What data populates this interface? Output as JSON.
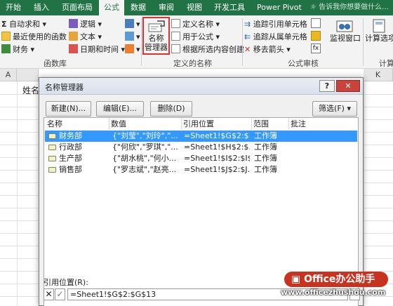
{
  "tabs": [
    {
      "label": "开始"
    },
    {
      "label": "插入"
    },
    {
      "label": "页面布局"
    },
    {
      "label": "公式"
    },
    {
      "label": "数据"
    },
    {
      "label": "审阅"
    },
    {
      "label": "视图"
    },
    {
      "label": "开发工具"
    },
    {
      "label": "Power Pivot"
    }
  ],
  "tell_me": "告诉我你想要做什么...",
  "ribbon": {
    "library": {
      "autosum": "自动求和",
      "recent": "最近使用的函数",
      "finance": "财务",
      "logic": "逻辑",
      "text": "文本",
      "datetime": "日期和时间",
      "label": "函数库"
    },
    "names": {
      "manager_line1": "名称",
      "manager_line2": "管理器",
      "define_name": "定义名称",
      "use_in_formula": "用于公式",
      "create_from_selection": "根据所选内容创建",
      "label": "定义的名称"
    },
    "audit": {
      "trace_precedents": "追踪引用单元格",
      "trace_dependents": "追踪从属单元格",
      "remove_arrows": "移去箭头",
      "watch_window": "监视窗口",
      "label": "公式审核"
    },
    "calc": {
      "options": "计算选项",
      "label": "计算"
    }
  },
  "sheet": {
    "col_a": "A",
    "col_k": "K",
    "cell_b1": "姓名"
  },
  "dialog": {
    "title": "名称管理器",
    "help": "?",
    "close": "✕",
    "new_button": "新建(N)...",
    "edit_button": "编辑(E)...",
    "delete_button": "删除(D)",
    "filter_button": "筛选(F) ▾",
    "columns": [
      "名称",
      "数值",
      "引用位置",
      "范围",
      "批注"
    ],
    "rows": [
      {
        "name": "财务部",
        "value": "{\"刘莹\",\"刘玲\",\"...",
        "ref": "=Sheet1!$G$2:$...",
        "scope": "工作簿",
        "selected": true
      },
      {
        "name": "行政部",
        "value": "{\"何欣\",\"罗琪\",\"...",
        "ref": "=Sheet1!$H$2:$...",
        "scope": "工作簿",
        "selected": false
      },
      {
        "name": "生产部",
        "value": "{\"胡水桃\",\"何小...",
        "ref": "=Sheet1!$I$2:$I$...",
        "scope": "工作簿",
        "selected": false
      },
      {
        "name": "销售部",
        "value": "{\"罗志斌\",\"赵亮...",
        "ref": "=Sheet1!$J$2:$J...",
        "scope": "工作簿",
        "selected": false
      }
    ],
    "ref_label": "引用位置(R):",
    "ref_value": "=Sheet1!$G$2:$G$13"
  },
  "watermark": {
    "logo": "Office办公助手",
    "url": "www.officezhushou.com"
  },
  "colors": {
    "excel_green": "#217346",
    "selection_blue": "#3399ff",
    "highlight_red": "#e03030"
  }
}
